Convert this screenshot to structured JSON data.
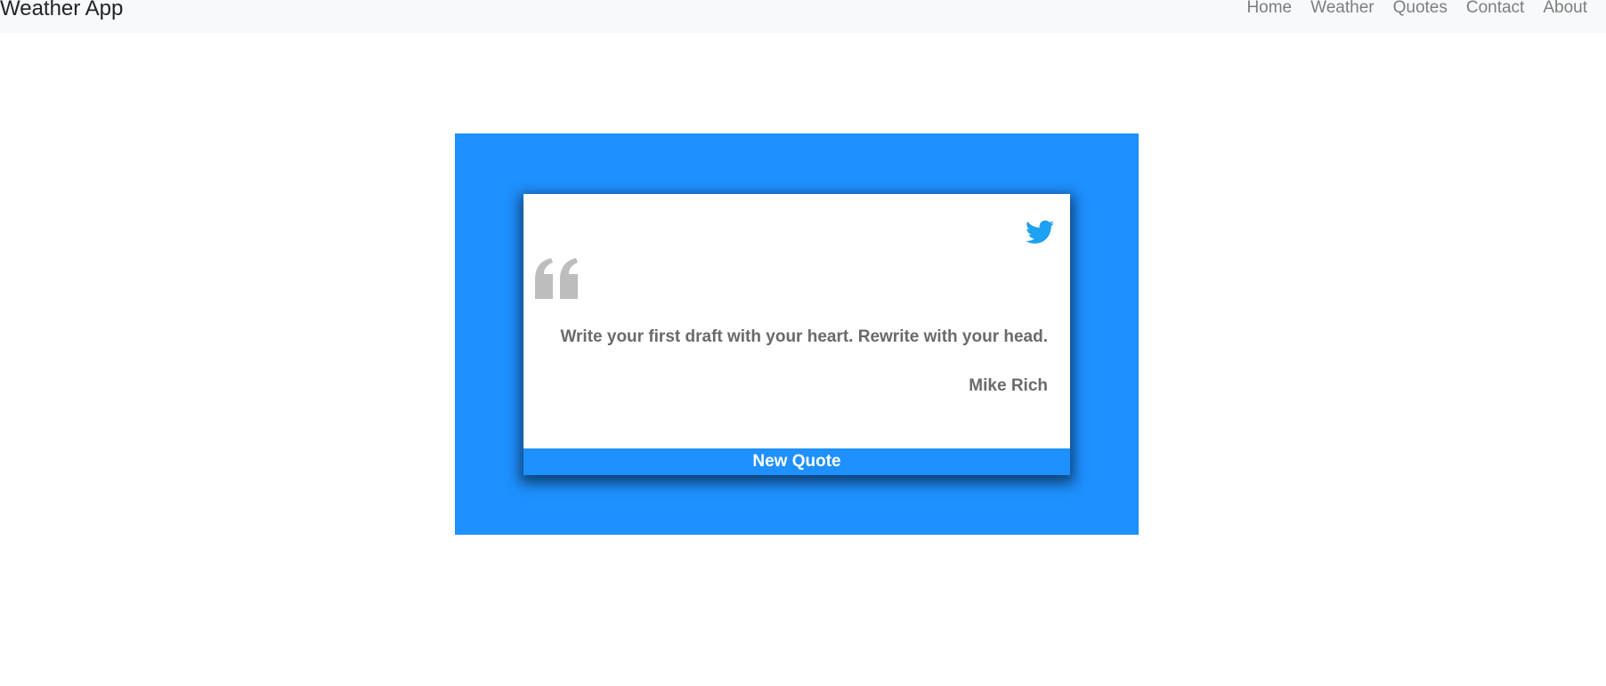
{
  "navbar": {
    "brand": "Weather App",
    "links": [
      {
        "label": "Home"
      },
      {
        "label": "Weather"
      },
      {
        "label": "Quotes"
      },
      {
        "label": "Contact"
      },
      {
        "label": "About"
      }
    ]
  },
  "quote_card": {
    "quote_icon": "quote-left-icon",
    "tweet_icon": "twitter-icon",
    "text": "Write your first draft with your heart. Rewrite with your head.",
    "author": "Mike Rich",
    "new_quote_label": "New Quote"
  },
  "colors": {
    "accent": "#1e90ff",
    "navbar_bg": "#f8f9fa",
    "quote_text": "#6a6a6a",
    "quote_mark": "#bdbdbd"
  }
}
